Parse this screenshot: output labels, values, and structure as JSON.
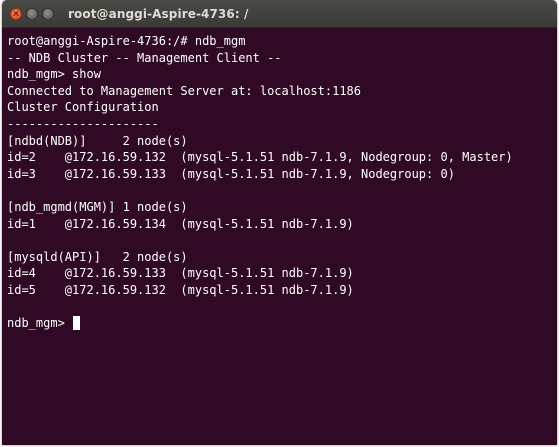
{
  "window": {
    "title": "root@anggi-Aspire-4736: /"
  },
  "terminal": {
    "lines": [
      "root@anggi-Aspire-4736:/# ndb_mgm",
      "-- NDB Cluster -- Management Client --",
      "ndb_mgm> show",
      "Connected to Management Server at: localhost:1186",
      "Cluster Configuration",
      "---------------------",
      "[ndbd(NDB)]     2 node(s)",
      "id=2    @172.16.59.132  (mysql-5.1.51 ndb-7.1.9, Nodegroup: 0, Master)",
      "id=3    @172.16.59.133  (mysql-5.1.51 ndb-7.1.9, Nodegroup: 0)",
      "",
      "[ndb_mgmd(MGM)] 1 node(s)",
      "id=1    @172.16.59.134  (mysql-5.1.51 ndb-7.1.9)",
      "",
      "[mysqld(API)]   2 node(s)",
      "id=4    @172.16.59.133  (mysql-5.1.51 ndb-7.1.9)",
      "id=5    @172.16.59.132  (mysql-5.1.51 ndb-7.1.9)",
      ""
    ],
    "prompt": "ndb_mgm> "
  },
  "colors": {
    "terminal_background": "#300a24",
    "terminal_text": "#ffffff",
    "titlebar": "#3c3b37",
    "close_button": "#e0562a"
  },
  "icons": {
    "close": "close-icon",
    "minimize": "minimize-icon",
    "maximize": "maximize-icon"
  }
}
